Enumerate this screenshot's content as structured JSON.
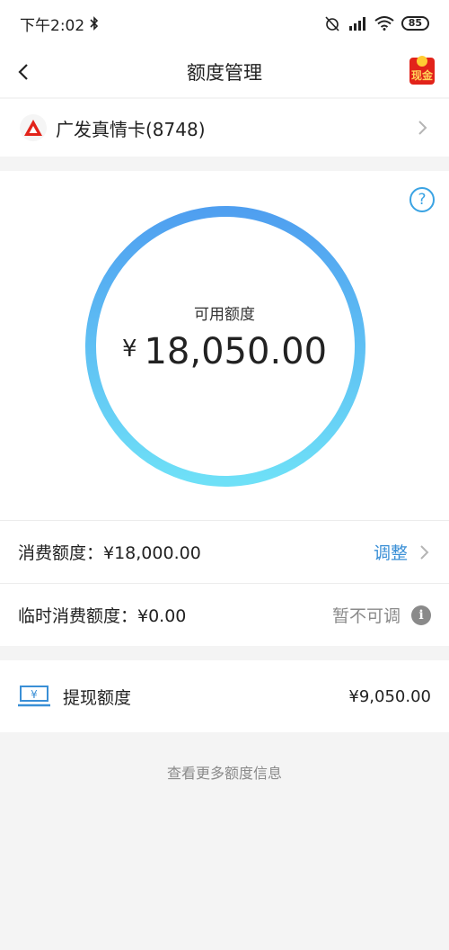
{
  "status_bar": {
    "time": "下午2:02",
    "battery": "85"
  },
  "header": {
    "title": "额度管理",
    "cash_badge": "现金"
  },
  "card": {
    "name": "广发真情卡(8748)"
  },
  "limit": {
    "label": "可用额度",
    "currency": "¥",
    "amount": "18,050.00"
  },
  "rows": [
    {
      "label": "消费额度：¥18,000.00",
      "action": "调整"
    },
    {
      "label": "临时消费额度：¥0.00",
      "action": "暂不可调"
    }
  ],
  "withdraw": {
    "label": "提现额度",
    "amount": "¥9,050.00"
  },
  "more_link": "查看更多额度信息",
  "colors": {
    "accent": "#3a8fd6",
    "ring_start": "#4f9ff0",
    "ring_end": "#6ee0f7",
    "brand_red": "#e2231a"
  }
}
